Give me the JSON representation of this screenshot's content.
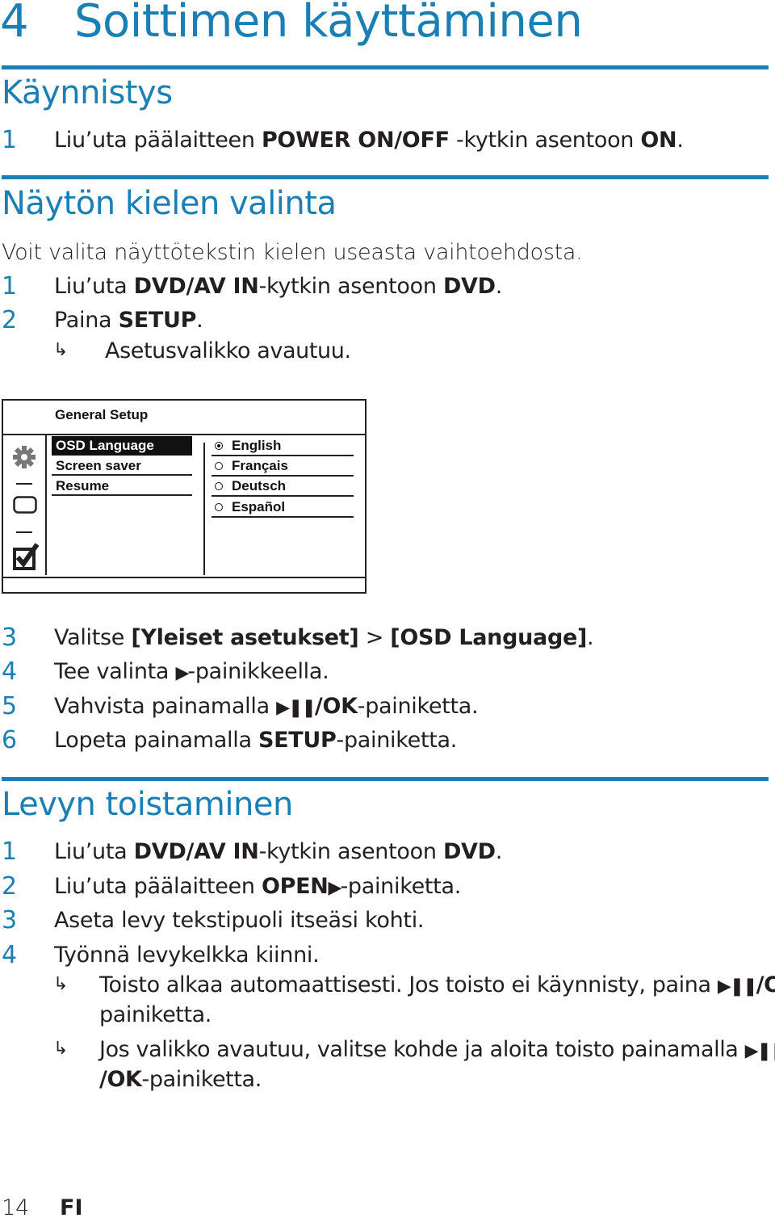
{
  "chapter": {
    "number": "4",
    "title": "Soittimen käyttäminen"
  },
  "sections": {
    "startup": {
      "heading": "Käynnistys",
      "steps": [
        {
          "n": "1",
          "pre": "Liu’uta päälaitteen ",
          "b1": "POWER ON/OFF",
          "mid": " -kytkin asentoon ",
          "b2": "ON",
          "post": "."
        }
      ]
    },
    "language": {
      "heading": "Näytön kielen valinta",
      "intro": "Voit valita näyttötekstin kielen useasta vaihtoehdosta.",
      "steps": [
        {
          "n": "1",
          "pre": "Liu’uta ",
          "b1": "DVD/AV IN",
          "mid": "-kytkin asentoon ",
          "b2": "DVD",
          "post": "."
        },
        {
          "n": "2",
          "pre": "Paina ",
          "b1": "SETUP",
          "post": "."
        },
        {
          "n": "3",
          "pre": "Valitse ",
          "b1": "[Yleiset asetukset]",
          "mid": " > ",
          "b2": "[OSD Language]",
          "post": "."
        },
        {
          "n": "4",
          "pre": "Tee valinta ",
          "sym": "▶",
          "post": "-painikkeella."
        },
        {
          "n": "5",
          "pre": "Vahvista painamalla ",
          "sym": "▶❚❚",
          "b1": "/OK",
          "post": "-painiketta."
        },
        {
          "n": "6",
          "pre": "Lopeta painamalla ",
          "b1": "SETUP",
          "post": "-painiketta."
        }
      ],
      "result_after_step2": "Asetusvalikko avautuu."
    },
    "playback": {
      "heading": "Levyn toistaminen",
      "steps": [
        {
          "n": "1",
          "pre": "Liu’uta ",
          "b1": "DVD/AV IN",
          "mid": "-kytkin asentoon ",
          "b2": "DVD",
          "post": "."
        },
        {
          "n": "2",
          "pre": "Liu’uta päälaitteen ",
          "b1": "OPEN",
          "sym": "▶",
          "post": "-painiketta."
        },
        {
          "n": "3",
          "pre": "Aseta levy tekstipuoli itseäsi kohti."
        },
        {
          "n": "4",
          "pre": "Työnnä levykelkka kiinni."
        }
      ],
      "results": [
        {
          "line1_pre": "Toisto alkaa automaattisesti. Jos toisto ei käynnisty, paina ",
          "sym": "▶❚❚",
          "b1": "/OK-",
          "line2": "painiketta."
        },
        {
          "line1_pre": "Jos valikko avautuu, valitse kohde ja aloita toisto painamalla ",
          "sym": "▶❚❚",
          "line2_b": "/OK",
          "line2": "-painiketta."
        }
      ]
    }
  },
  "result_arrow_icon": "↳",
  "osd_menu": {
    "title": "General Setup",
    "side_icons": [
      "gear-icon",
      "rectangle-icon",
      "checkbox-icon"
    ],
    "items": [
      {
        "label": "OSD Language",
        "selected": true
      },
      {
        "label": "Screen saver",
        "selected": false
      },
      {
        "label": "Resume",
        "selected": false
      }
    ],
    "options": [
      {
        "label": "English",
        "checked": true
      },
      {
        "label": "Français",
        "checked": false
      },
      {
        "label": "Deutsch",
        "checked": false
      },
      {
        "label": "Español",
        "checked": false
      }
    ]
  },
  "footer": {
    "page": "14",
    "lang": "FI"
  },
  "colors": {
    "accent": "#1a7fb5",
    "text": "#231f20"
  }
}
